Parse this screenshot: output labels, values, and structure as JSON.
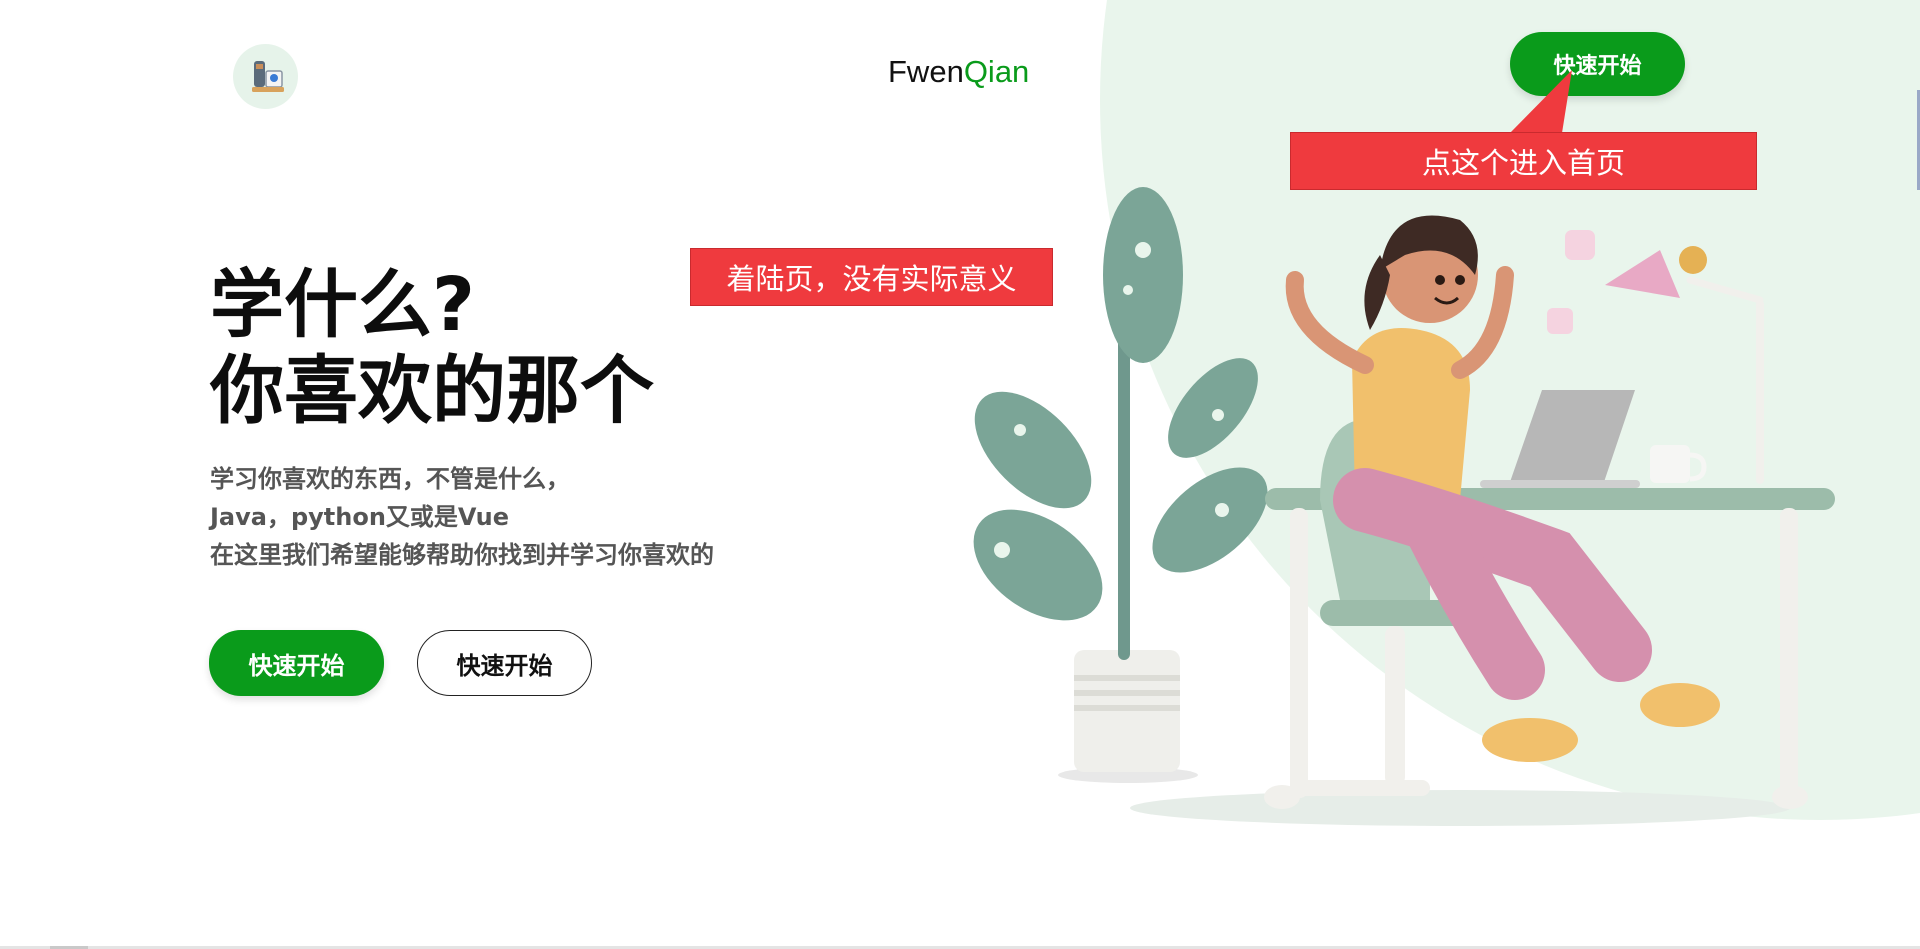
{
  "header": {
    "brand_prefix": "Fwen",
    "brand_accent": "Qian",
    "cta_label": "快速开始"
  },
  "annotations": {
    "top_callout": "点这个进入首页",
    "mid_callout": "着陆页，没有实际意义"
  },
  "hero": {
    "title_line1": "学什么?",
    "title_line2": "你喜欢的那个",
    "desc_line1": "学习你喜欢的东西，不管是什么，",
    "desc_line2": "Java，python又或是Vue",
    "desc_line3": "在这里我们希望能够帮助你找到并学习你喜欢的",
    "primary_button": "快速开始",
    "secondary_button": "快速开始"
  },
  "colors": {
    "accent": "#0a9b1b",
    "callout": "#ef3a3e",
    "circle_bg": "#e9f5ec"
  }
}
